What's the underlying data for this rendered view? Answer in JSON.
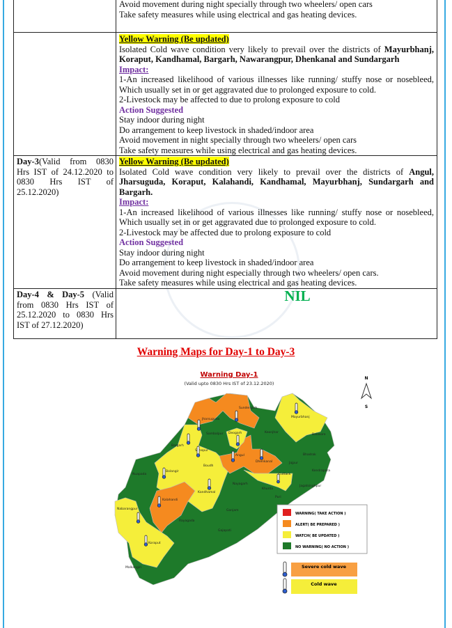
{
  "row_prev": {
    "lines": [
      "Avoid movement during night specially through two wheelers/ open cars",
      "Take safety measures while using electrical and gas heating devices."
    ]
  },
  "row_day2_yellow": {
    "warning": "Yellow Warning (Be updated)",
    "text_pre": "Isolated Cold wave condition very likely to prevail over the districts of ",
    "districts": "Mayurbhanj, Koraput, Kandhamal, Bargarh, Nawarangpur, Dhenkanal and Sundargarh",
    "impact_label": "Impact:",
    "impact": [
      "1-An increased likelihood of various illnesses like running/ stuffy nose or nosebleed, Which usually set in or get aggravated due to prolonged exposure to cold.",
      "2-Livestock may be affected to due to prolong exposure to cold"
    ],
    "action_label": "Action Suggested",
    "actions": [
      "Stay indoor during night",
      "Do arrangement to keep livestock in shaded/indoor area",
      "Avoid movement in night specially through two wheelers/ open cars",
      "Take safety measures while using electrical and gas heating devices."
    ]
  },
  "row_day3": {
    "day": "Day-3",
    "validity": "(Valid from 0830 Hrs IST of 24.12.2020 to 0830 Hrs IST of 25.12.2020)",
    "warning": "Yellow Warning (Be updated)",
    "text_pre": "Isolated Cold wave condition very likely to prevail over the districts of ",
    "districts": "Angul, Jharsuguda, Koraput, Kalahandi, Kandhamal, Mayurbhanj, Sundargarh and Bargarh.",
    "impact_label": "Impact:",
    "impact": [
      "1-An increased likelihood of various illnesses like running/ stuffy nose or nosebleed, Which usually set in or get aggravated due to prolonged exposure to cold.",
      "2-Livestock may be affected due to prolong exposure to cold"
    ],
    "action_label": "Action Suggested",
    "actions": [
      "Stay indoor during night",
      "Do arrangement to keep livestock in shaded/indoor area",
      "Avoid movement during night especially through two wheelers/ open cars.",
      "Take safety measures while using electrical and gas heating devices."
    ]
  },
  "row_day45": {
    "day": "Day-4 & Day-5",
    "validity": " (Valid from 0830 Hrs IST of 25.12.2020 to 0830 Hrs IST of 27.12.2020)",
    "status": "NIL"
  },
  "maps_title": "Warning Maps for Day-1 to Day-3",
  "map": {
    "title": "Warning Day-1",
    "subtitle": "(Valid upto 0830 Hrs IST of 23.12.2020)",
    "compass_n": "N",
    "compass_s": "S",
    "districts": [
      "Sundergarh",
      "Jharsuguda",
      "Mayurbhanj",
      "Sambalpur",
      "Deogarh",
      "Keonjhar",
      "Balasore",
      "Bargarh",
      "Sonepur",
      "Angul",
      "Dhenkanal",
      "Bhadrak",
      "Jajpur",
      "Boudh",
      "Kendrapara",
      "Nuapada",
      "Bolangir",
      "Cuttack",
      "Nayagarh",
      "Jagatsinghpur",
      "Khurda",
      "Kalahandi",
      "Kandhamal",
      "Puri",
      "Ganjam",
      "Nabarangpur",
      "Rayagada",
      "Gajapati",
      "Koraput",
      "Malkangiri"
    ],
    "legend": [
      {
        "label": "WARNING( TAKE ACTION )",
        "color": "#e02020"
      },
      {
        "label": "ALERT( BE PREPARED )",
        "color": "#f58a1f"
      },
      {
        "label": "WATCH( BE UPDATED )",
        "color": "#f5ee3a"
      },
      {
        "label": "NO WARNING( NO ACTION )",
        "color": "#1e7a2a"
      }
    ],
    "wave_legend": [
      {
        "label": "Severe cold wave",
        "color": "#f8a043"
      },
      {
        "label": "Cold wave",
        "color": "#f5ee3a"
      }
    ]
  }
}
